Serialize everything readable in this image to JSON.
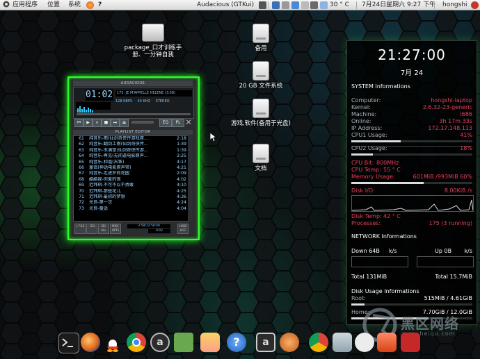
{
  "top_panel": {
    "menu_apps": "应用程序",
    "menu_places": "位置",
    "menu_system": "系统",
    "help": "?",
    "window_title": "Audacious (GTKui)",
    "temperature": "30 ° C",
    "datetime": "7月24日星期六  9:27 下午",
    "user": "hongshi"
  },
  "desktop": {
    "icons": [
      {
        "label": "package_口才训练手册、一分钟自我",
        "icon": "package-icon"
      },
      {
        "label": "备用",
        "icon": "drive-icon"
      },
      {
        "label": "20 GB 文件系统",
        "icon": "drive-icon"
      },
      {
        "label": "游戏,软件(备用于光盘)",
        "icon": "drive-icon"
      },
      {
        "label": "文档",
        "icon": "drive-icon"
      }
    ]
  },
  "audacious": {
    "title": "AUDACIOUS",
    "time": "01:02",
    "song": "175. JE M'APPELLE HELENE (3:58)",
    "bitrate": "128 KBPS",
    "rate": "44 KHZ",
    "channels": "STEREO",
    "eq_label": "EQ",
    "pl_label": "PL",
    "playlist_title": "PLAYLIST EDITOR",
    "playlist": [
      {
        "n": "61",
        "title": "纯音乐-雨(仙剑奇侠传游戏原...",
        "dur": "2:18"
      },
      {
        "n": "62",
        "title": "纯音乐-翻剑工雨(仙剑奇侠传...",
        "dur": "1:39"
      },
      {
        "n": "63",
        "title": "纯音乐-玉满堂(仙剑奇侠传游...",
        "dur": "1:39"
      },
      {
        "n": "64",
        "title": "纯音乐-再见(无间道电影原声...",
        "dur": "2:25"
      },
      {
        "n": "65",
        "title": "纯音乐-和谐(古筝)",
        "dur": "4:17"
      },
      {
        "n": "66",
        "title": "童谣(神话电影原声带)",
        "dur": "4:21"
      },
      {
        "n": "67",
        "title": "纯音乐-走进罗莉花园",
        "dur": "2:09"
      },
      {
        "n": "68",
        "title": "酷酷妮-你爱的很",
        "dur": "4:02"
      },
      {
        "n": "69",
        "title": "范玮琪-不可不以不勇敢",
        "dur": "4:10"
      },
      {
        "n": "70",
        "title": "范玮琪-那些花儿",
        "dur": "4:25"
      },
      {
        "n": "71",
        "title": "范玮琪-最初的梦想",
        "dur": "4:36"
      },
      {
        "n": "72",
        "title": "光良-第一次",
        "dur": "4:24"
      },
      {
        "n": "73",
        "title": "光良-童话",
        "dur": "4:04"
      }
    ],
    "pl_buttons": [
      "+ FILE",
      "- SEL",
      "SEL ALL",
      "MISC OPTS",
      "LOAD LIST"
    ],
    "pl_time": "3:58/12:58:49",
    "pl_time2": "0:02"
  },
  "conky": {
    "time": "21:27:00",
    "date": "7月 24",
    "system_header": "SYSTEM Informations",
    "computer_label": "Computer:",
    "computer": "hongshi-laptop",
    "kernel_label": "Kernel:",
    "kernel": "2.6.32-23-generic",
    "machine_label": "Machine:",
    "machine": "i686",
    "online_label": "Online:",
    "online": "3h 17m 33s",
    "ip_label": "IP Address:",
    "ip": "172.17.148.113",
    "cpu1_label": "CPU1 Usage:",
    "cpu1": "41%",
    "cpu1_value": 41,
    "cpu2_label": "CPU2 Usage:",
    "cpu2": "18%",
    "cpu2_value": 18,
    "cpubit_label": "CPU Bit:",
    "cpubit": "800MHz",
    "cputemp_label": "CPU Temp:",
    "cputemp": "55 ° C",
    "mem_label": "Memory Usage:",
    "mem": "601MiB /993MiB 60%",
    "mem_value": 60,
    "disk_io_label": "Disk I/O:",
    "disk_io": "8.00KiB /s",
    "disk_temp_label": "Disk Temp:",
    "disk_temp": "42 ° C",
    "processes_label": "Processes:",
    "processes": "175 (3 running)",
    "network_header": "NETWORK Informations",
    "down_label": "Down 64B",
    "down_unit": "k/s",
    "up_label": "Up 0B",
    "up_unit": "k/s",
    "total_down": "Total 131MiB",
    "total_up": "Total 15.7MiB",
    "disk_header": "Disk Usage Informations",
    "root_label": "Root:",
    "root": "515MiB / 4.61GiB",
    "root_value": 11,
    "home_label": "Home:",
    "home": "7.70GiB / 12.0GiB",
    "home_value": 64
  },
  "watermark": {
    "text": "黑区网络",
    "url": "www.heiqu.com"
  },
  "colors": {
    "accent_green": "#2aff2a",
    "conky_red": "#e6405a",
    "panel": "#e6e6e6"
  }
}
